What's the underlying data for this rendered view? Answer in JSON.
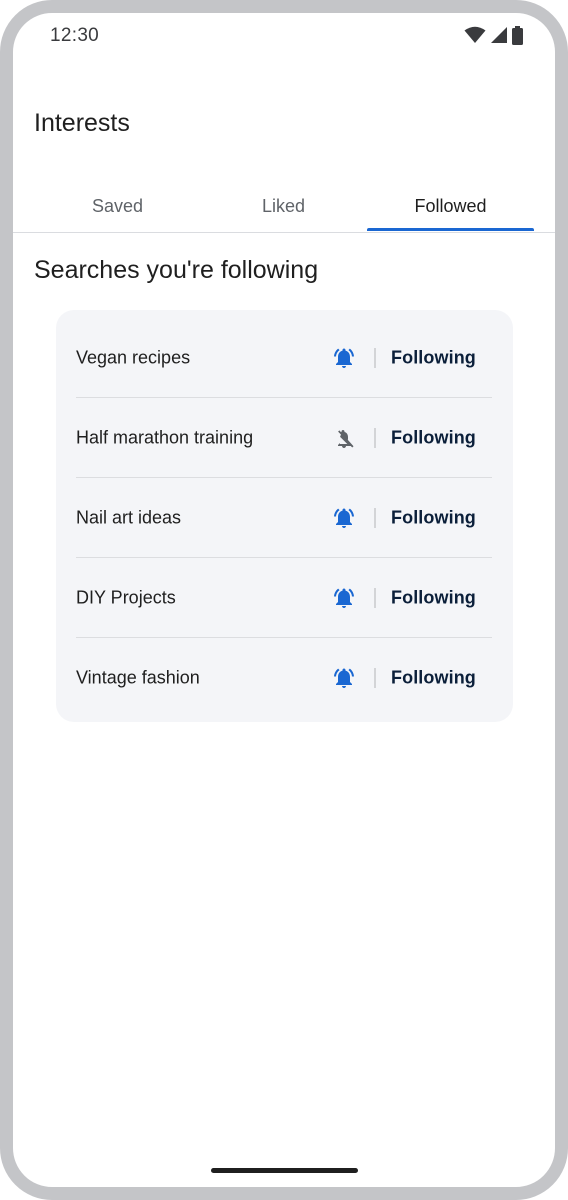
{
  "status_bar": {
    "time": "12:30",
    "icons": [
      "wifi-icon",
      "cellular-signal-icon",
      "battery-icon"
    ]
  },
  "header": {
    "title": "Interests"
  },
  "tabs": [
    {
      "label": "Saved",
      "active": false
    },
    {
      "label": "Liked",
      "active": false
    },
    {
      "label": "Followed",
      "active": true
    }
  ],
  "section": {
    "title": "Searches you're following"
  },
  "follows": [
    {
      "label": "Vegan recipes",
      "notifications": "on",
      "icon": "bell-active-icon",
      "button": "Following"
    },
    {
      "label": "Half marathon training",
      "notifications": "off",
      "icon": "bell-off-icon",
      "button": "Following"
    },
    {
      "label": "Nail art ideas",
      "notifications": "on",
      "icon": "bell-active-icon",
      "button": "Following"
    },
    {
      "label": "DIY Projects",
      "notifications": "on",
      "icon": "bell-active-icon",
      "button": "Following"
    },
    {
      "label": "Vintage fashion",
      "notifications": "on",
      "icon": "bell-active-icon",
      "button": "Following"
    }
  ],
  "colors": {
    "accent": "#1a67d2",
    "bell_active": "#1a67d2",
    "bell_off": "#5f6368",
    "card_bg": "#f4f5f8",
    "button_text": "#0b1f3a"
  }
}
